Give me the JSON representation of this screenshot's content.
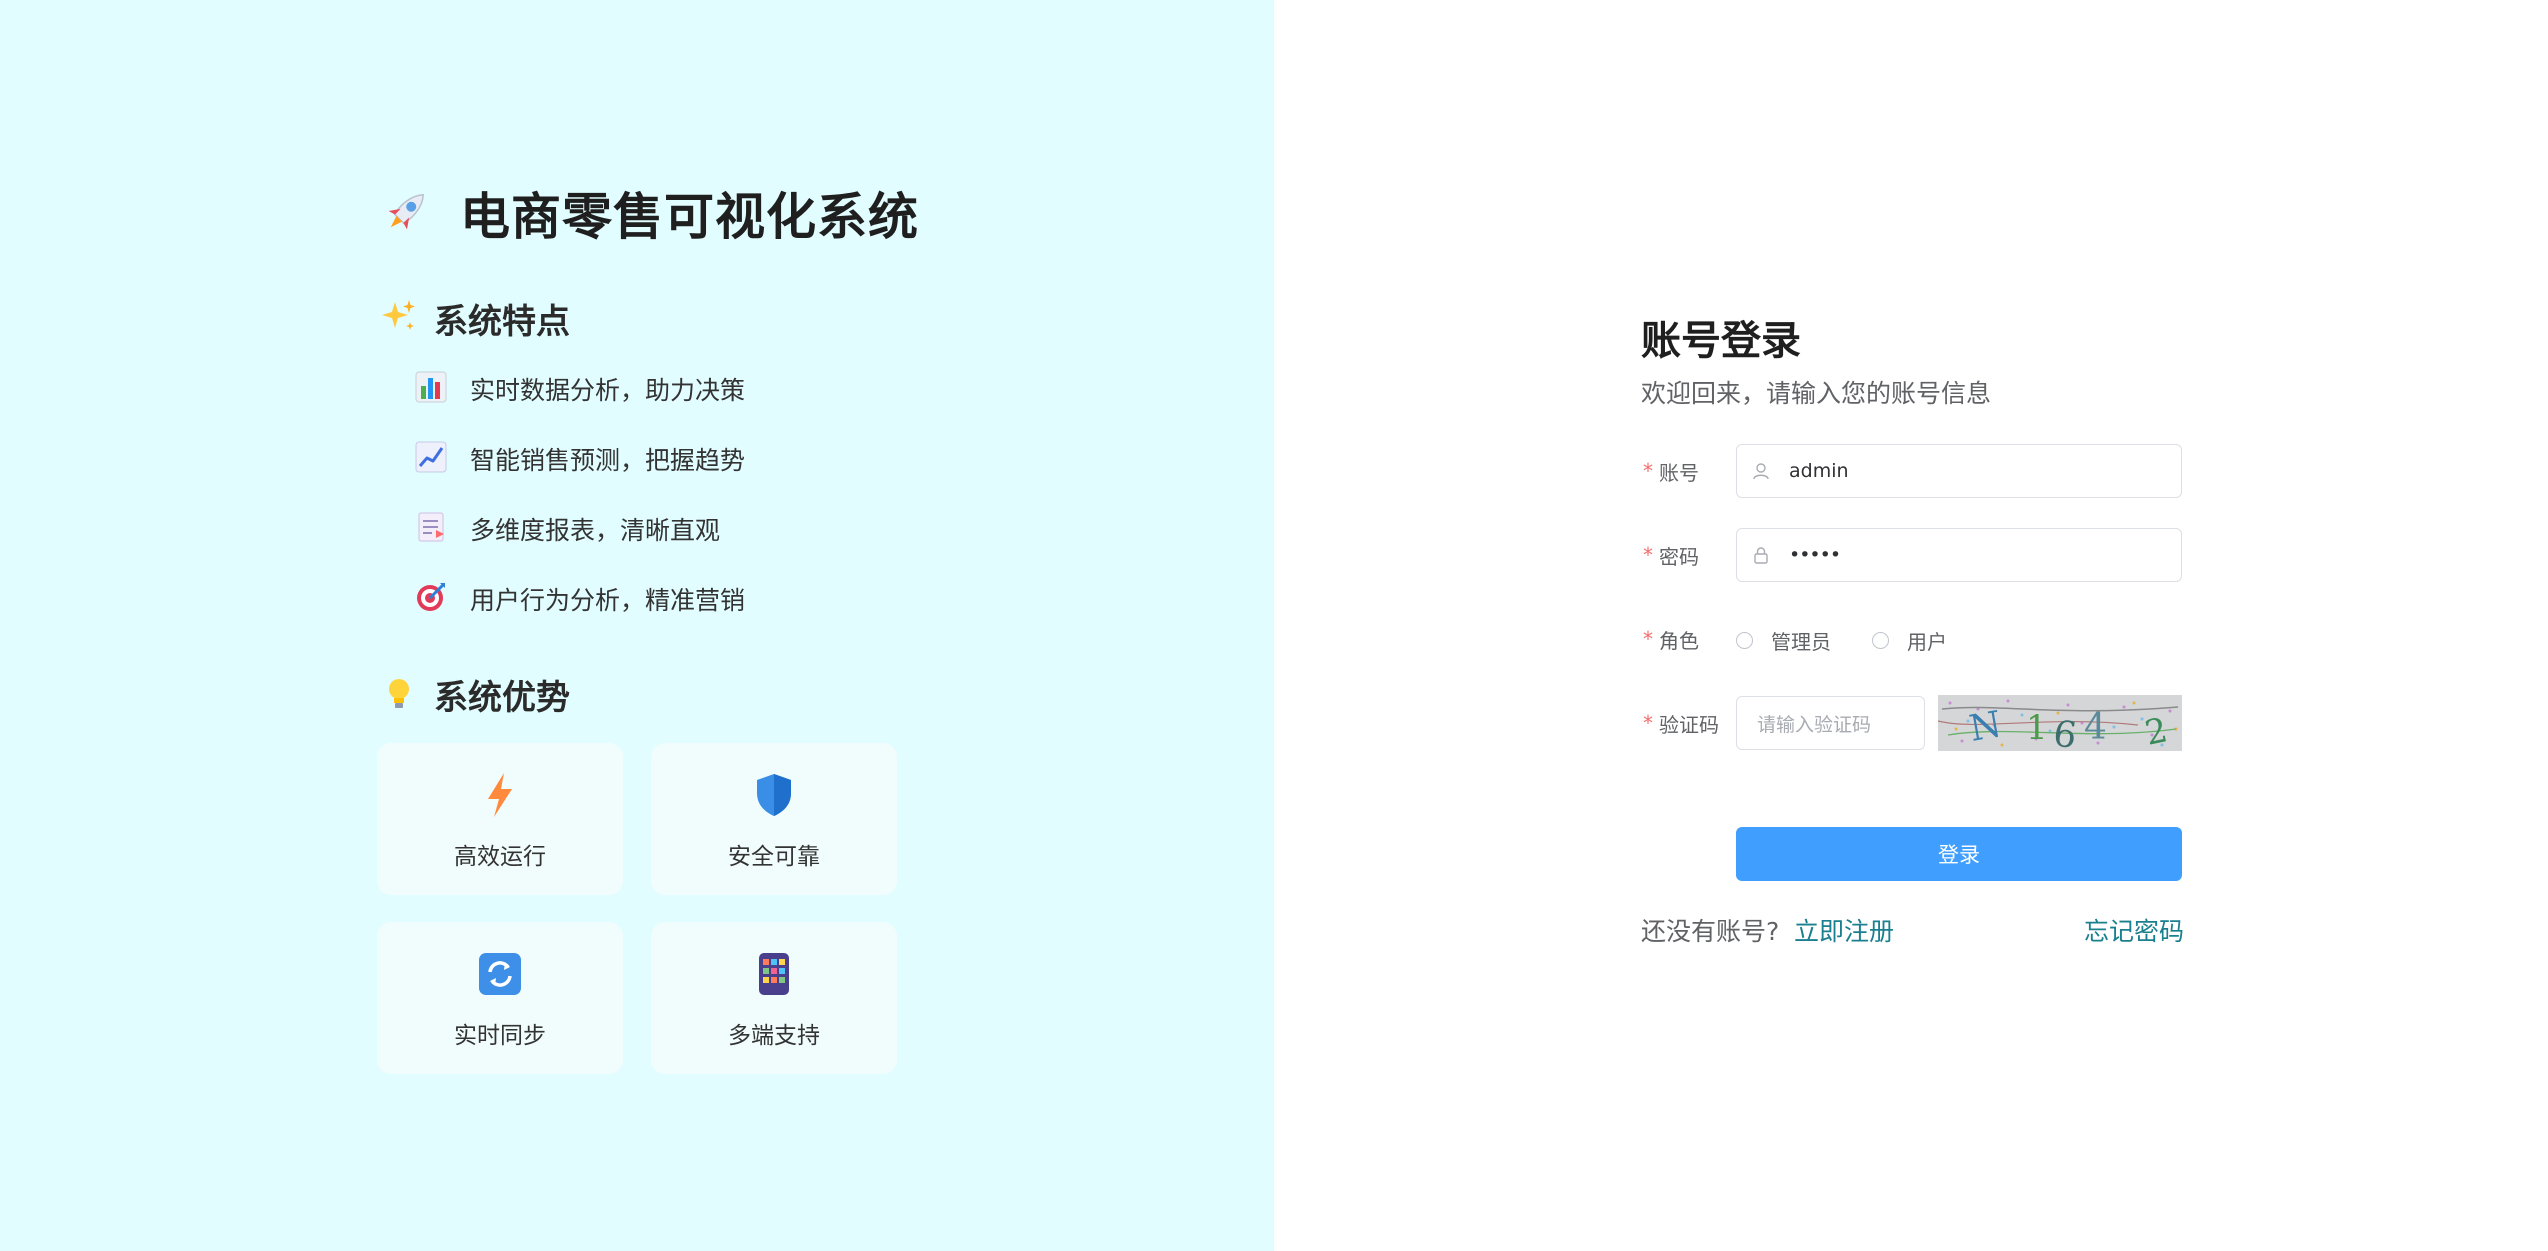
{
  "app_title": "电商零售可视化系统",
  "features": {
    "title": "系统特点",
    "items": [
      {
        "icon": "bar-chart-icon",
        "text": "实时数据分析，助力决策"
      },
      {
        "icon": "trend-chart-icon",
        "text": "智能销售预测，把握趋势"
      },
      {
        "icon": "report-icon",
        "text": "多维度报表，清晰直观"
      },
      {
        "icon": "target-icon",
        "text": "用户行为分析，精准营销"
      }
    ]
  },
  "advantages": {
    "title": "系统优势",
    "cards": [
      {
        "icon": "lightning-icon",
        "label": "高效运行"
      },
      {
        "icon": "shield-icon",
        "label": "安全可靠"
      },
      {
        "icon": "sync-icon",
        "label": "实时同步"
      },
      {
        "icon": "mobile-icon",
        "label": "多端支持"
      }
    ]
  },
  "login": {
    "title": "账号登录",
    "subtitle": "欢迎回来，请输入您的账号信息",
    "required_mark": "*",
    "account_label": "账号",
    "account_value": "admin",
    "password_label": "密码",
    "password_value": "•••••",
    "role_label": "角色",
    "roles": [
      "管理员",
      "用户"
    ],
    "captcha_label": "验证码",
    "captcha_placeholder": "请输入验证码",
    "captcha_image_text": "N 1 6 4 2",
    "submit": "登录",
    "no_account_text": "还没有账号?",
    "register_link": "立即注册",
    "forgot_link": "忘记密码"
  },
  "colors": {
    "left_bg": "#e2fdff",
    "primary": "#409eff",
    "link": "#1a7f8e",
    "required": "#f56c6c"
  }
}
